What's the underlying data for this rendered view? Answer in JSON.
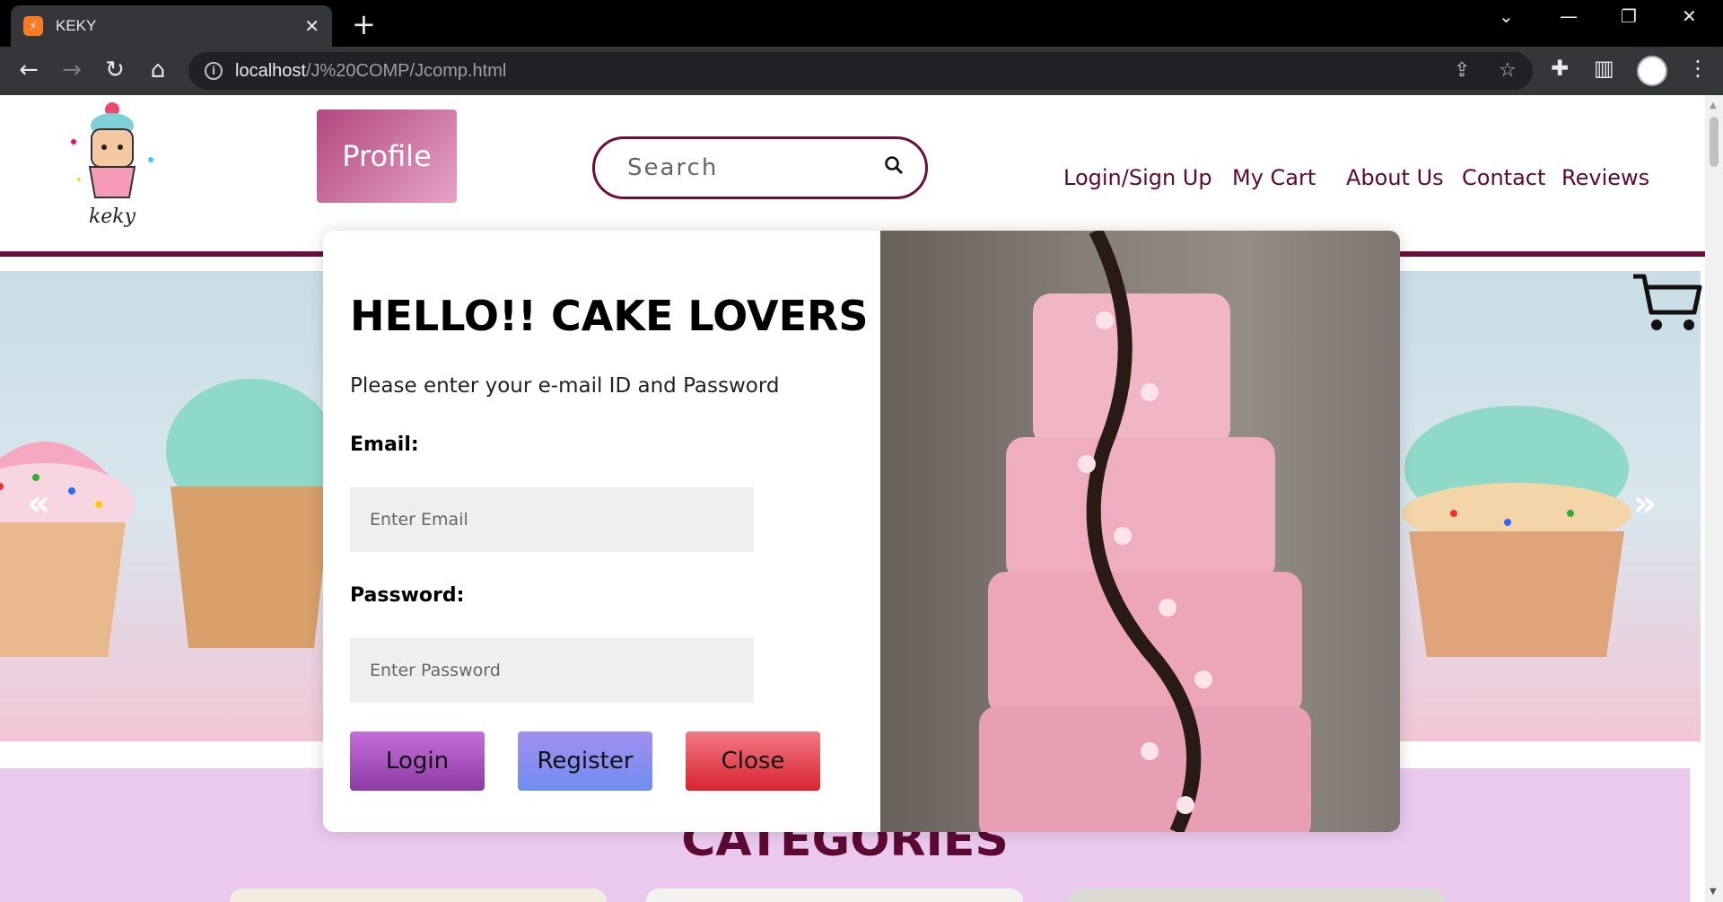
{
  "browser": {
    "tab_title": "KEKY",
    "favicon_text": "ꟽ",
    "url_host": "localhost",
    "url_path": "/J%20COMP/Jcomp.html"
  },
  "header": {
    "logo_text": "keky",
    "profile_label": "Profile",
    "search_placeholder": "Search",
    "nav": [
      "Login/Sign Up",
      "My Cart",
      "About Us",
      "Contact",
      "Reviews"
    ]
  },
  "hero": {
    "prev_arrow": "«",
    "next_arrow": "»"
  },
  "categories": {
    "title": "CATEGORIES"
  },
  "modal": {
    "title": "HELLO!! CAKE LOVERS",
    "subtitle": "Please enter your e-mail ID and Password",
    "email_label": "Email:",
    "email_placeholder": "Enter Email",
    "password_label": "Password:",
    "password_placeholder": "Enter Password",
    "login_label": "Login",
    "register_label": "Register",
    "close_label": "Close"
  },
  "colors": {
    "brand": "#6d0e3c",
    "login_btn": "#9b4fc0",
    "register_btn": "#7f8ff2",
    "close_btn": "#e03040"
  }
}
